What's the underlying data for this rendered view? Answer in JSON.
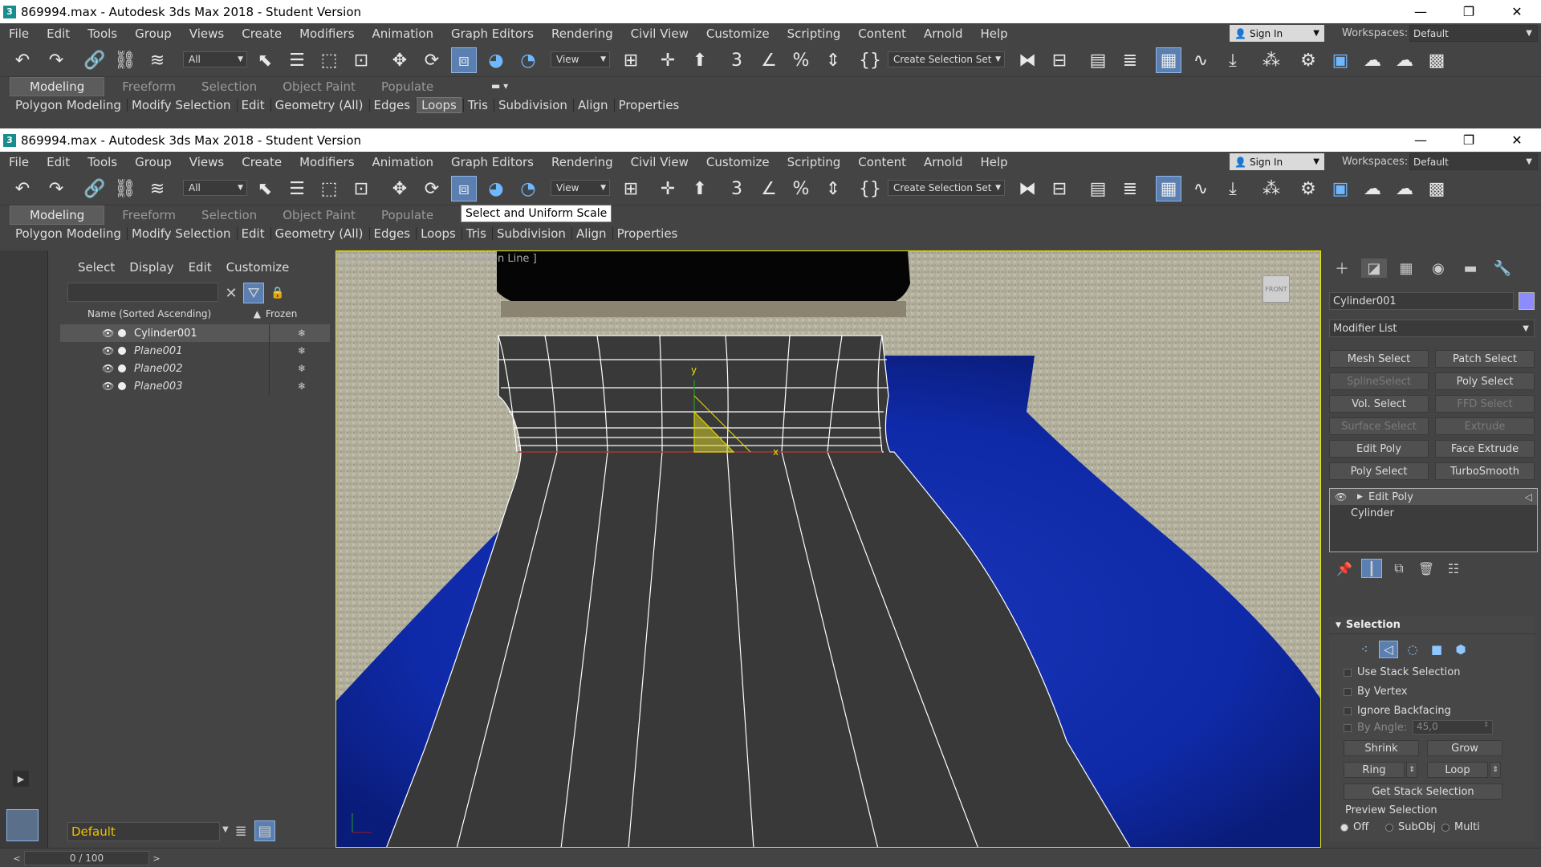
{
  "title": "869994.max - Autodesk 3ds Max 2018 - Student Version",
  "app_icon": "3",
  "window_buttons": {
    "minimize": "—",
    "restore": "❐",
    "close": "✕"
  },
  "menu": [
    "File",
    "Edit",
    "Tools",
    "Group",
    "Views",
    "Create",
    "Modifiers",
    "Animation",
    "Graph Editors",
    "Rendering",
    "Civil View",
    "Customize",
    "Scripting",
    "Content",
    "Arnold",
    "Help"
  ],
  "sign_in": "Sign In",
  "workspaces_label": "Workspaces:",
  "workspace_value": "Default",
  "toolbar": {
    "filter_value": "All",
    "ref_coord_value": "View",
    "selection_set": "Create Selection Set"
  },
  "ribbon_tabs": [
    "Modeling",
    "Freeform",
    "Selection",
    "Object Paint",
    "Populate"
  ],
  "ribbon_panels": [
    "Polygon Modeling",
    "Modify Selection",
    "Edit",
    "Geometry (All)",
    "Edges",
    "Loops",
    "Tris",
    "Subdivision",
    "Align",
    "Properties"
  ],
  "tooltip": "Select and Uniform Scale",
  "scene_explorer": {
    "menu": [
      "Select",
      "Display",
      "Edit",
      "Customize"
    ],
    "col_name": "Name (Sorted Ascending)",
    "col_frozen": "Frozen",
    "rows": [
      {
        "name": "Cylinder001",
        "selected": true
      },
      {
        "name": "Plane001",
        "selected": false
      },
      {
        "name": "Plane002",
        "selected": false
      },
      {
        "name": "Plane003",
        "selected": false
      }
    ],
    "layer": "Default"
  },
  "viewport": {
    "label": "[+] [Front ] [Standard ] [Hidden Line ]",
    "viewcube": "FRONT",
    "axis_x": "x",
    "axis_y": "y"
  },
  "command_panel": {
    "object_name": "Cylinder001",
    "object_color": "#8c8cff",
    "modifier_list": "Modifier List",
    "modifier_buttons": [
      {
        "label": "Mesh Select",
        "enabled": true
      },
      {
        "label": "Patch Select",
        "enabled": true
      },
      {
        "label": "SplineSelect",
        "enabled": false
      },
      {
        "label": "Poly Select",
        "enabled": true
      },
      {
        "label": "Vol. Select",
        "enabled": true
      },
      {
        "label": "FFD Select",
        "enabled": false
      },
      {
        "label": "Surface Select",
        "enabled": false
      },
      {
        "label": "Extrude",
        "enabled": false
      },
      {
        "label": "Edit Poly",
        "enabled": true
      },
      {
        "label": "Face Extrude",
        "enabled": true
      },
      {
        "label": "Poly Select",
        "enabled": true
      },
      {
        "label": "TurboSmooth",
        "enabled": true
      }
    ],
    "stack": [
      "Edit Poly",
      "Cylinder"
    ],
    "selection_title": "Selection",
    "use_stack_selection": "Use Stack Selection",
    "by_vertex": "By Vertex",
    "ignore_backfacing": "Ignore Backfacing",
    "by_angle": "By Angle:",
    "by_angle_value": "45,0",
    "shrink": "Shrink",
    "grow": "Grow",
    "ring": "Ring",
    "loop": "Loop",
    "get_stack_selection": "Get Stack Selection",
    "preview_selection": "Preview Selection",
    "preview_options": [
      "Off",
      "SubObj",
      "Multi"
    ]
  },
  "status": {
    "time": "0 / 100",
    "prev": "<",
    "next": ">"
  },
  "colors": {
    "accent": "#5a7fb0",
    "viewport_border": "#e8e800",
    "layer_text": "#f0c000"
  }
}
